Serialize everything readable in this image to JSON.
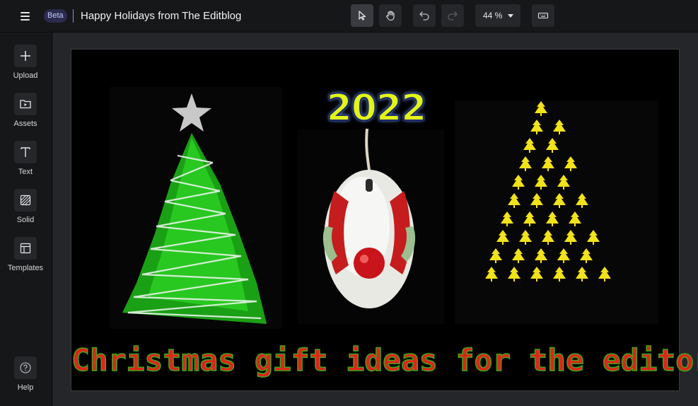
{
  "header": {
    "badge": "Beta",
    "title": "Happy Holidays from The Editblog",
    "zoom_value": "44 %"
  },
  "toolbar": {
    "tools": [
      {
        "name": "select-tool",
        "icon": "cursor-arrow-icon",
        "active": true
      },
      {
        "name": "hand-tool",
        "icon": "hand-icon",
        "active": false
      },
      {
        "name": "undo",
        "icon": "undo-icon",
        "active": false
      },
      {
        "name": "redo",
        "icon": "redo-icon",
        "active": false
      },
      {
        "name": "keyboard-shortcuts",
        "icon": "keyboard-icon",
        "active": false
      }
    ]
  },
  "sidebar": {
    "items": [
      {
        "label": "Upload",
        "icon": "plus-icon"
      },
      {
        "label": "Assets",
        "icon": "folder-play-icon"
      },
      {
        "label": "Text",
        "icon": "text-t-icon"
      },
      {
        "label": "Solid",
        "icon": "hatched-square-icon"
      },
      {
        "label": "Templates",
        "icon": "layout-icon"
      }
    ],
    "help": {
      "label": "Help",
      "icon": "question-circle-icon"
    }
  },
  "canvas": {
    "year_text": "2022",
    "caption_text": "Christmas gift ideas for the editor.",
    "background_color": "#000000",
    "caption_color": "#e0241a",
    "caption_outline_color": "#3fa51c",
    "year_color": "#e2f516",
    "tree_left_color": "#22c41a",
    "tree_right_color": "#f2e21a",
    "mouse_button_color": "#c8141a"
  },
  "colors": {
    "accent": "#8a8cff",
    "chrome_bg": "#161719",
    "workspace_bg": "#25262a"
  }
}
